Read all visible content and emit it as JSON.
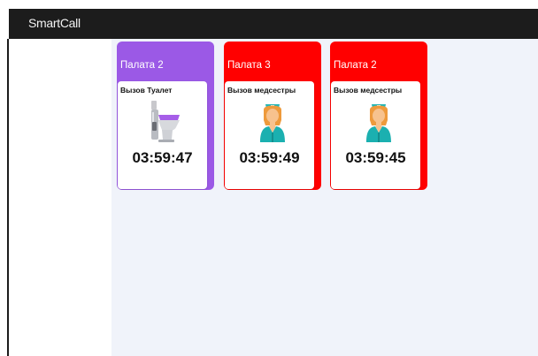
{
  "app": {
    "brand": "SmartCall"
  },
  "cards": [
    {
      "room": "Палата 2",
      "call_type": "Вызов Туалет",
      "timer": "03:59:47",
      "icon": "toilet-icon",
      "color": "#9b59e6"
    },
    {
      "room": "Палата 3",
      "call_type": "Вызов медсестры",
      "timer": "03:59:49",
      "icon": "nurse-icon",
      "color": "#ff0000"
    },
    {
      "room": "Палата 2",
      "call_type": "Вызов медсестры",
      "timer": "03:59:45",
      "icon": "nurse-icon",
      "color": "#ff0000"
    }
  ]
}
